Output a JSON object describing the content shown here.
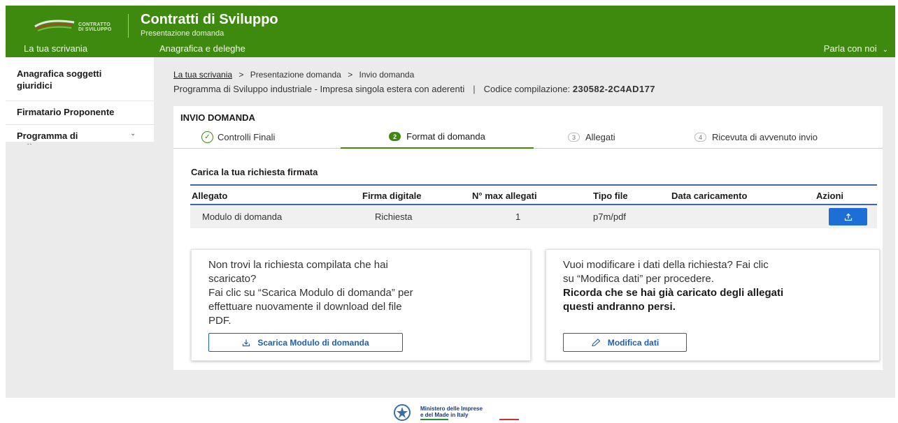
{
  "header": {
    "logo_text_line1": "CONTRATTO",
    "logo_text_line2": "DI SVILUPPO",
    "app_title": "Contratti di Sviluppo",
    "app_subtitle": "Presentazione domanda",
    "nav": [
      "La tua scrivania",
      "Anagrafica e deleghe"
    ],
    "nav_right": "Parla con noi"
  },
  "sidebar": {
    "items": [
      {
        "label_line1": "Anagrafica soggetti",
        "label_line2": "giuridici"
      },
      {
        "label_line1": "Firmatario Proponente"
      },
      {
        "label_line1": "Programma di",
        "label_line2": "sviluppo"
      }
    ]
  },
  "breadcrumb": {
    "home": "La tua scrivania",
    "items": [
      "Presentazione domanda",
      "Invio domanda"
    ],
    "separator": ">"
  },
  "context": {
    "programma": "Programma di Sviluppo industriale - Impresa singola estera con aderenti",
    "code_label": "Codice compilazione:",
    "code_value": "230582-2C4AD177"
  },
  "card": {
    "title": "INVIO DOMANDA",
    "steps": [
      {
        "num": "",
        "label": "Controlli Finali",
        "state": "done"
      },
      {
        "num": "2",
        "label": "Format di domanda",
        "state": "active"
      },
      {
        "num": "3",
        "label": "Allegati",
        "state": "todo"
      },
      {
        "num": "4",
        "label": "Ricevuta di avvenuto invio",
        "state": "todo"
      }
    ],
    "section_title": "Carica la tua richiesta firmata",
    "table": {
      "headers": [
        "Allegato",
        "Firma digitale",
        "N° max allegati",
        "Tipo file",
        "Data caricamento",
        "Azioni"
      ],
      "rows": [
        [
          "Modulo di domanda",
          "Richiesta",
          "1",
          "p7m/pdf",
          ""
        ]
      ]
    },
    "box_left": {
      "line1": "Non trovi la richiesta compilata che hai",
      "line2": "scaricato?",
      "line3": "Fai clic su “Scarica Modulo di domanda” per",
      "line4": "effettuare nuovamente il download del file",
      "line5": "PDF.",
      "button": "Scarica Modulo di domanda"
    },
    "box_right": {
      "line1": "Vuoi modificare i dati della richiesta? Fai clic",
      "line2": "su “Modifica dati” per procedere.",
      "line3_bold": "Ricorda che se hai già caricato degli allegati",
      "line4_bold": "questi andranno persi.",
      "button": "Modifica dati"
    }
  },
  "footer": {
    "ministry_line1": "Ministero delle Imprese",
    "ministry_line2": "e del Made in Italy"
  },
  "colors": {
    "brand_green": "#3e8a0f",
    "accent_blue": "#1d6fd6",
    "table_rule": "#3b67b0"
  },
  "icons": {
    "nav_right_chevron": "chevron-down-icon",
    "sidebar_chevron": "chevron-down-icon",
    "step_done": "check-circle-icon",
    "upload": "upload-icon",
    "download": "download-icon",
    "edit": "pencil-icon"
  }
}
